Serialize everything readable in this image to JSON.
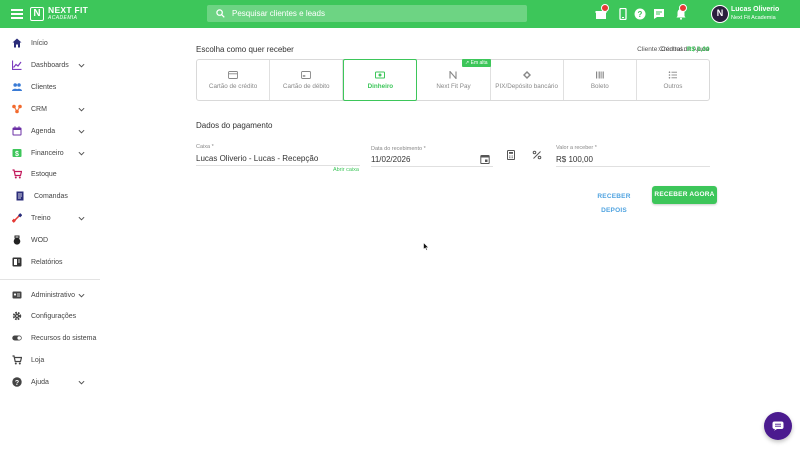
{
  "header": {
    "brand_name": "NEXT FIT",
    "brand_sub": "ACADEMIA",
    "search_placeholder": "Pesquisar clientes e leads",
    "user_name": "Lucas Oliverio",
    "user_org": "Next Fit Academia",
    "avatar_letter": "N"
  },
  "sidebar": {
    "items": [
      {
        "label": "Início",
        "icon": "home-icon"
      },
      {
        "label": "Dashboards",
        "icon": "chart-icon"
      },
      {
        "label": "Clientes",
        "icon": "people-icon"
      },
      {
        "label": "CRM",
        "icon": "crm-icon"
      },
      {
        "label": "Agenda",
        "icon": "calendar-icon"
      },
      {
        "label": "Financeiro",
        "icon": "money-icon"
      },
      {
        "label": "Estoque",
        "icon": "cart-icon"
      },
      {
        "label": "Comandas",
        "icon": "receipt-icon"
      },
      {
        "label": "Treino",
        "icon": "dumbbell-icon"
      },
      {
        "label": "WOD",
        "icon": "kettlebell-icon"
      },
      {
        "label": "Relatórios",
        "icon": "report-icon"
      },
      {
        "label": "Administrativo",
        "icon": "id-card-icon"
      },
      {
        "label": "Configurações",
        "icon": "gear-icon"
      },
      {
        "label": "Recursos do sistema",
        "icon": "toggle-icon"
      },
      {
        "label": "Loja",
        "icon": "store-icon"
      },
      {
        "label": "Ajuda",
        "icon": "help-icon"
      }
    ]
  },
  "main": {
    "title": "Escolha como quer receber",
    "client_label": "Cliente: Central de Ajuda",
    "credits_label": "Créditos:",
    "credits_value": "R$ 0,00",
    "methods": [
      {
        "label": "Cartão de crédito",
        "icon": "credit-card-icon"
      },
      {
        "label": "Cartão de débito",
        "icon": "debit-card-icon"
      },
      {
        "label": "Dinheiro",
        "icon": "cash-icon"
      },
      {
        "label": "Next Fit Pay",
        "icon": "nextfit-icon"
      },
      {
        "label": "PIX/Depósito bancário",
        "icon": "pix-icon"
      },
      {
        "label": "Boleto",
        "icon": "barcode-icon"
      },
      {
        "label": "Outros",
        "icon": "list-icon"
      }
    ],
    "em_alta_tag": "Em alta",
    "section_title": "Dados do pagamento",
    "caixa_label": "Caixa *",
    "caixa_value": "Lucas Oliverio - Lucas - Recepção",
    "abrir_caixa": "Abrir caixa",
    "date_label": "Data do recebimento *",
    "date_value": "11/02/2026",
    "amount_label": "Valor a receber *",
    "amount_value": "R$ 100,00",
    "receive_later": "RECEBER DEPOIS",
    "receive_now": "RECEBER AGORA"
  },
  "colors": {
    "accent": "#3dc65a",
    "link": "#4fa3e0",
    "chat": "#4b1b8f"
  }
}
